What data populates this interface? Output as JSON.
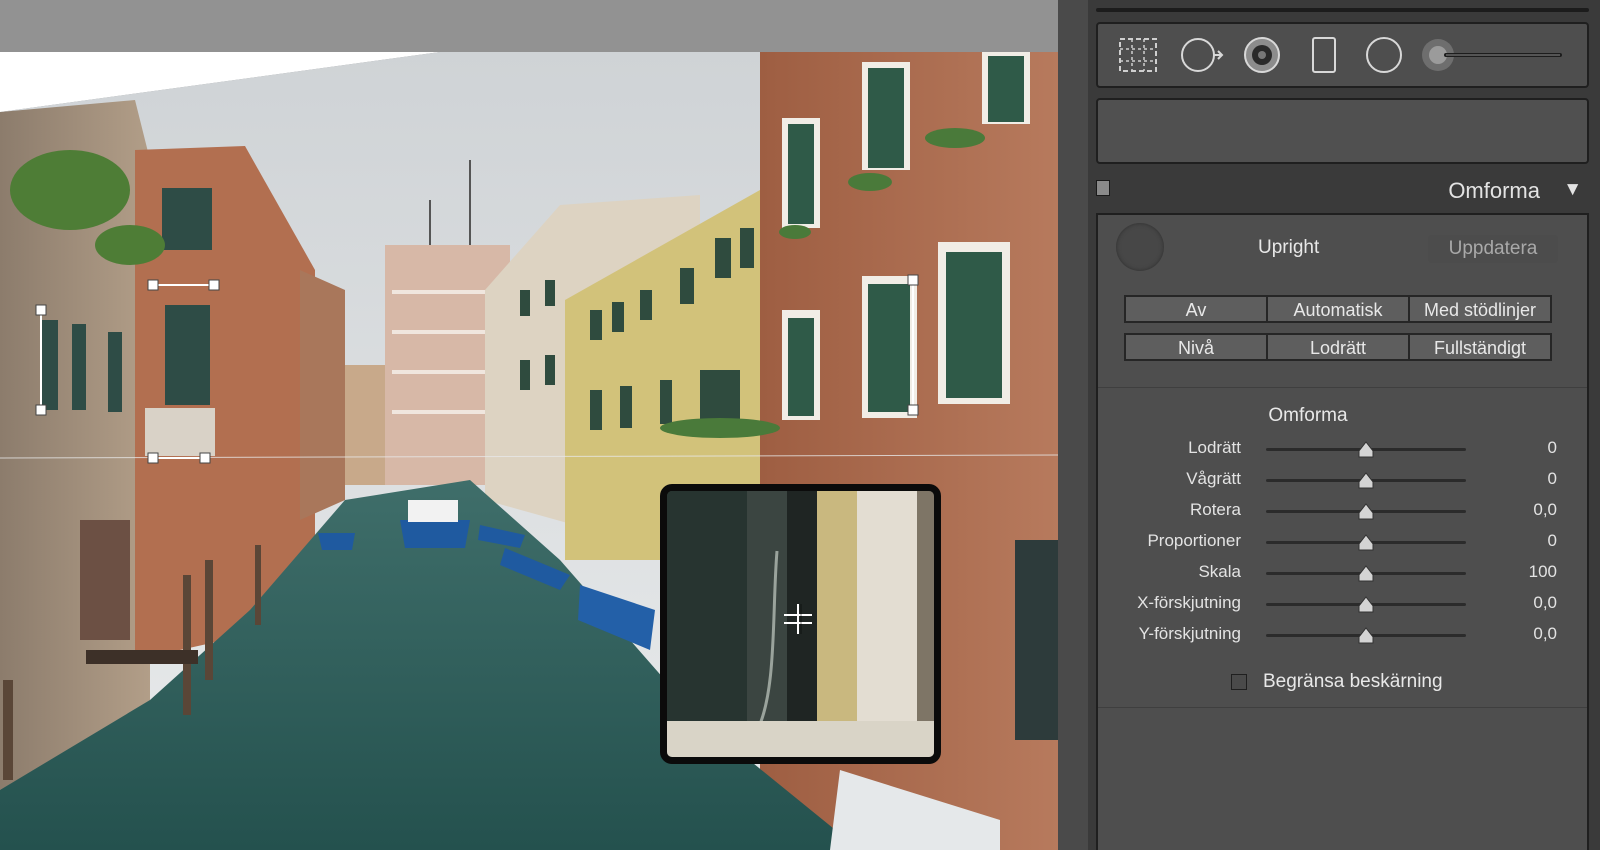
{
  "transform_panel": {
    "title": "Omforma",
    "upright": {
      "label": "Upright",
      "update_button": "Uppdatera",
      "mode_buttons_row1": [
        "Av",
        "Automatisk",
        "Med stödlinjer"
      ],
      "mode_buttons_row2": [
        "Nivå",
        "Lodrätt",
        "Fullständigt"
      ]
    },
    "sliders_title": "Omforma",
    "sliders": [
      {
        "label": "Lodrätt",
        "value": "0",
        "position": 0.5
      },
      {
        "label": "Vågrätt",
        "value": "0",
        "position": 0.5
      },
      {
        "label": "Rotera",
        "value": "0,0",
        "position": 0.5
      },
      {
        "label": "Proportioner",
        "value": "0",
        "position": 0.5
      },
      {
        "label": "Skala",
        "value": "100",
        "position": 0.5
      },
      {
        "label": "X-förskjutning",
        "value": "0,0",
        "position": 0.5
      },
      {
        "label": "Y-förskjutning",
        "value": "0,0",
        "position": 0.5
      }
    ],
    "limit_crop": {
      "label": "Begränsa beskärning",
      "checked": false
    }
  },
  "toolstrip": {
    "tools": [
      "crop-overlay-icon",
      "spot-removal-icon",
      "red-eye-icon",
      "graduated-filter-icon",
      "radial-filter-icon",
      "adjustment-brush-icon"
    ]
  },
  "colors": {
    "panel_bg": "#3a3a3a",
    "panel_body": "#4e4e4e",
    "text": "#e3e3e3",
    "canal_water": "#2f5b57"
  }
}
